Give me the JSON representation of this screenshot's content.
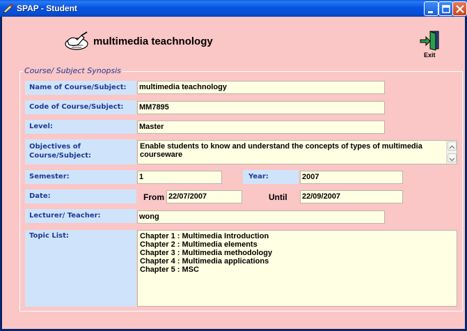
{
  "window": {
    "title": "SPAP - Student"
  },
  "header": {
    "title": "multimedia teachnology",
    "exit_label": "Exit"
  },
  "synopsis": {
    "group_caption": "Course/ Subject Synopsis",
    "name_label": "Name of Course/Subject:",
    "name_value": "multimedia teachnology",
    "code_label": "Code of Course/Subject:",
    "code_value": "MM7895",
    "level_label": "Level:",
    "level_value": "Master",
    "objectives_label": "Objectives of Course/Subject:",
    "objectives_value": "Enable students to know and understand the concepts of types of multimedia courseware",
    "semester_label": "Semester:",
    "semester_value": "1",
    "year_label": "Year:",
    "year_value": "2007",
    "date_label": "Date:",
    "from_label": "From",
    "from_value": "22/07/2007",
    "until_label": "Until",
    "until_value": "22/09/2007",
    "lecturer_label": "Lecturer/ Teacher:",
    "lecturer_value": "wong",
    "topic_label": "Topic List:",
    "topic_value": "Chapter 1 : Multimedia Introduction\nChapter 2 : Multimedia elements\nChapter 3 : Multimedia methodology\nChapter 4 : Multimedia applications\nChapter 5 : MSC"
  },
  "icons": {
    "app": "pen-app-icon",
    "header": "writing-hand-icon",
    "exit": "exit-door-icon",
    "minimize": "minimize-icon",
    "maximize": "maximize-icon",
    "close": "close-icon"
  }
}
